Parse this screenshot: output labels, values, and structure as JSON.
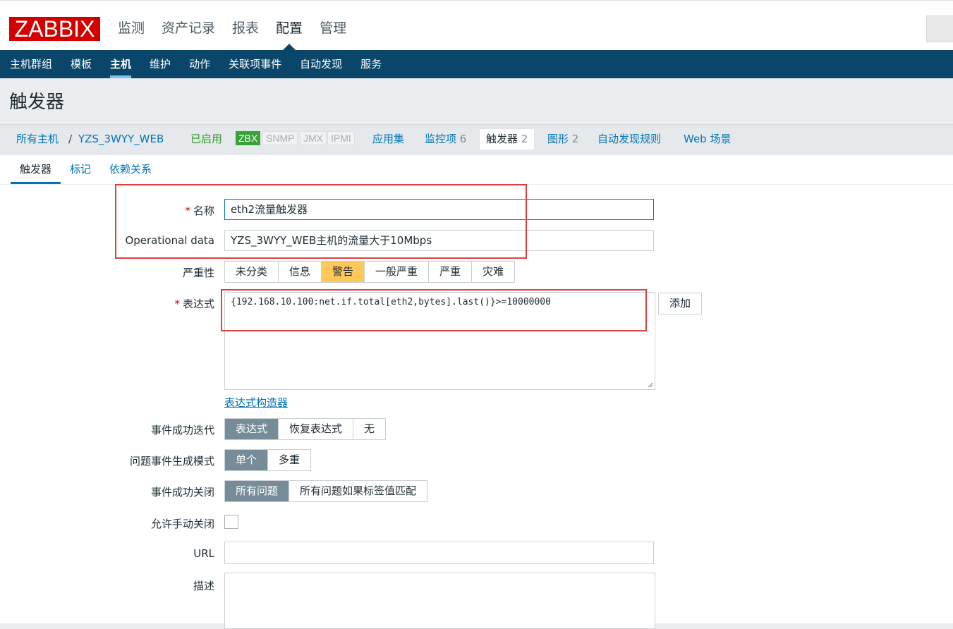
{
  "app": {
    "logo": "ZABBIX"
  },
  "main_menu": [
    {
      "label": "监测"
    },
    {
      "label": "资产记录"
    },
    {
      "label": "报表"
    },
    {
      "label": "配置",
      "active": true
    },
    {
      "label": "管理"
    }
  ],
  "sub_menu": [
    {
      "label": "主机群组"
    },
    {
      "label": "模板"
    },
    {
      "label": "主机",
      "active": true
    },
    {
      "label": "维护"
    },
    {
      "label": "动作"
    },
    {
      "label": "关联项事件"
    },
    {
      "label": "自动发现"
    },
    {
      "label": "服务"
    }
  ],
  "page_title": "触发器",
  "breadcrumb": {
    "all_hosts": "所有主机",
    "separator": "/",
    "host": "YZS_3WYY_WEB",
    "status": "已启用",
    "availability": [
      "ZBX",
      "SNMP",
      "JMX",
      "IPMI"
    ],
    "applications": "应用集",
    "items": "监控项",
    "items_count": "6",
    "triggers": "触发器",
    "triggers_count": "2",
    "graphs": "图形",
    "graphs_count": "2",
    "discovery": "自动发现规则",
    "web": "Web 场景"
  },
  "form_tabs": [
    {
      "label": "触发器",
      "active": true
    },
    {
      "label": "标记"
    },
    {
      "label": "依赖关系"
    }
  ],
  "form": {
    "name_label": "名称",
    "name_value": "eth2流量触发器",
    "opdata_label": "Operational data",
    "opdata_value": "YZS_3WYY_WEB主机的流量大于10Mbps",
    "severity_label": "严重性",
    "severity_options": [
      "未分类",
      "信息",
      "警告",
      "一般严重",
      "严重",
      "灾难"
    ],
    "severity_selected": "警告",
    "expression_label": "表达式",
    "expression_value": "{192.168.10.100:net.if.total[eth2,bytes].last()}>=10000000",
    "add_button": "添加",
    "expression_builder": "表达式构造器",
    "ok_event_gen_label": "事件成功迭代",
    "ok_event_gen_options": [
      "表达式",
      "恢复表达式",
      "无"
    ],
    "problem_mode_label": "问题事件生成模式",
    "problem_mode_options": [
      "单个",
      "多重"
    ],
    "ok_close_label": "事件成功关闭",
    "ok_close_options": [
      "所有问题",
      "所有问题如果标签值匹配"
    ],
    "manual_close_label": "允许手动关闭",
    "url_label": "URL",
    "url_value": "",
    "description_label": "描述"
  },
  "colors": {
    "brand": "#d40000",
    "nav": "#0a466a",
    "link": "#0275b8",
    "warning": "#ffc859",
    "selected": "#768d99",
    "highlight": "#e04040"
  }
}
